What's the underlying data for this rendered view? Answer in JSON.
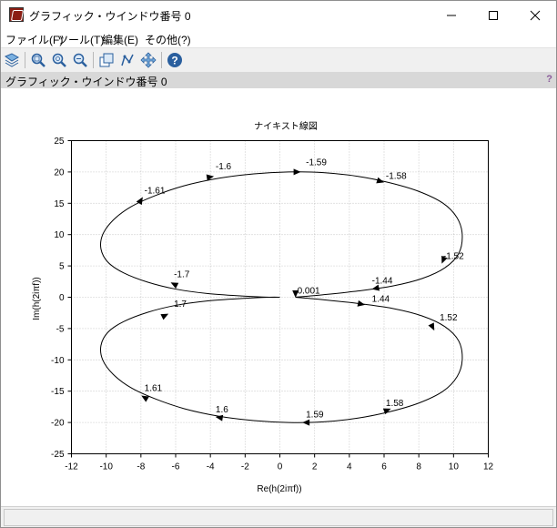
{
  "window": {
    "title": "グラフィック・ウインドウ番号 0"
  },
  "menu": [
    {
      "label": "ファイル(F)"
    },
    {
      "label": "ツール(T)"
    },
    {
      "label": "編集(E)"
    },
    {
      "label": "その他(?)"
    }
  ],
  "figure": {
    "header_title": "グラフィック・ウインドウ番号 0",
    "help": "?"
  },
  "chart_data": {
    "type": "line",
    "title": "ナイキスト線図",
    "xlabel": "Re(h(2iπf))",
    "ylabel": "Im(h(2iπf))",
    "xlim": [
      -12,
      12
    ],
    "ylim": [
      -25,
      25
    ],
    "xticks": [
      -12,
      -10,
      -8,
      -6,
      -4,
      -2,
      0,
      2,
      4,
      6,
      8,
      10,
      12
    ],
    "yticks": [
      -25,
      -20,
      -15,
      -10,
      -5,
      0,
      5,
      10,
      15,
      20,
      25
    ],
    "grid": true,
    "series": [
      {
        "x": [
          0.9,
          2.5,
          4.5,
          6.5,
          8.2,
          9.5,
          10.3,
          10.5,
          10.2,
          9.4,
          8.0,
          6.3,
          4.5,
          2.5,
          0.5,
          -1.5,
          -3.5,
          -5.5,
          -7.2,
          -8.6,
          -9.6,
          -10.2,
          -10.3,
          -9.9,
          -9.0,
          -7.6,
          -6.0,
          -4.2,
          -2.2,
          -0.6,
          0.0
        ],
        "y": [
          0.0,
          0.4,
          1.0,
          1.8,
          3.0,
          4.7,
          7.0,
          10.0,
          12.7,
          15.0,
          16.9,
          18.3,
          19.3,
          19.9,
          20.0,
          19.7,
          19.0,
          17.8,
          16.2,
          14.4,
          12.3,
          10.0,
          7.7,
          5.6,
          3.9,
          2.4,
          1.3,
          0.6,
          0.2,
          0.0,
          0.0
        ]
      },
      {
        "x": [
          0.9,
          2.5,
          4.5,
          6.5,
          8.2,
          9.5,
          10.3,
          10.5,
          10.2,
          9.4,
          8.0,
          6.3,
          4.5,
          2.5,
          0.5,
          -1.5,
          -3.5,
          -5.5,
          -7.2,
          -8.6,
          -9.6,
          -10.2,
          -10.3,
          -9.9,
          -9.0,
          -7.6,
          -6.0,
          -4.2,
          -2.2,
          -0.6,
          0.0
        ],
        "y": [
          0.0,
          -0.4,
          -1.0,
          -1.8,
          -3.0,
          -4.7,
          -7.0,
          -10.0,
          -12.7,
          -15.0,
          -16.9,
          -18.3,
          -19.3,
          -19.9,
          -20.0,
          -19.7,
          -19.0,
          -17.8,
          -16.2,
          -14.4,
          -12.3,
          -10.0,
          -7.7,
          -5.6,
          -3.9,
          -2.4,
          -1.3,
          -0.6,
          -0.2,
          0.0,
          0.0
        ]
      }
    ],
    "annotations": [
      {
        "text": "0.001",
        "x": 1.0,
        "y": 0.6
      },
      {
        "text": "-1.44",
        "x": 5.3,
        "y": 2.2
      },
      {
        "text": "1.44",
        "x": 5.3,
        "y": -0.7
      },
      {
        "text": "-1.52",
        "x": 9.4,
        "y": 6.1
      },
      {
        "text": "1.52",
        "x": 9.2,
        "y": -3.7
      },
      {
        "text": "-1.58",
        "x": 6.1,
        "y": 18.9
      },
      {
        "text": "1.58",
        "x": 6.1,
        "y": -17.4
      },
      {
        "text": "-1.59",
        "x": 1.5,
        "y": 21.1
      },
      {
        "text": "1.59",
        "x": 1.5,
        "y": -19.2
      },
      {
        "text": "-1.6",
        "x": -3.7,
        "y": 20.4
      },
      {
        "text": "1.6",
        "x": -3.7,
        "y": -18.4
      },
      {
        "text": "-1.61",
        "x": -7.8,
        "y": 16.6
      },
      {
        "text": "1.61",
        "x": -7.8,
        "y": -15.0
      },
      {
        "text": "-1.7",
        "x": -6.1,
        "y": 3.2
      },
      {
        "text": "1.7",
        "x": -6.1,
        "y": -1.5
      }
    ],
    "arrows": [
      {
        "x": 0.9,
        "y": 0.5,
        "dx": 0,
        "dy": -1
      },
      {
        "x": 5.5,
        "y": 1.4,
        "dx": -1,
        "dy": -0.2
      },
      {
        "x": 4.7,
        "y": -1.1,
        "dx": 1,
        "dy": -0.2
      },
      {
        "x": 9.4,
        "y": 5.9,
        "dx": -0.4,
        "dy": -1
      },
      {
        "x": 8.8,
        "y": -4.8,
        "dx": 0.5,
        "dy": -1
      },
      {
        "x": 5.8,
        "y": 18.5,
        "dx": 1,
        "dy": -0.3
      },
      {
        "x": 6.2,
        "y": -18.0,
        "dx": 1,
        "dy": 0.4
      },
      {
        "x": 1.0,
        "y": 20.0,
        "dx": 1,
        "dy": 0
      },
      {
        "x": 1.5,
        "y": -20.0,
        "dx": -1,
        "dy": 0
      },
      {
        "x": -4.0,
        "y": 19.2,
        "dx": 1,
        "dy": 0.15
      },
      {
        "x": -3.5,
        "y": -19.2,
        "dx": -1,
        "dy": 0.15
      },
      {
        "x": -8.0,
        "y": 15.5,
        "dx": 0.6,
        "dy": 1
      },
      {
        "x": -7.8,
        "y": -16.0,
        "dx": -1,
        "dy": 0.6
      },
      {
        "x": -6.1,
        "y": 2.1,
        "dx": -1,
        "dy": 0.5
      },
      {
        "x": -6.6,
        "y": -2.9,
        "dx": 1,
        "dy": 0.5
      }
    ]
  }
}
